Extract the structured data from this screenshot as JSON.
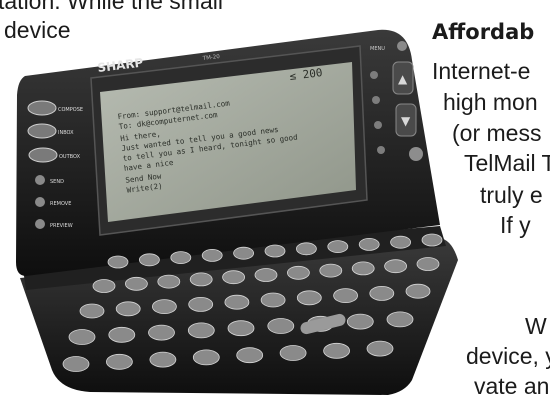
{
  "left_column": {
    "line1": "tation. While the small",
    "line2": "device"
  },
  "right_column": {
    "heading": "Affordab",
    "lines": [
      "Internet-e",
      "high mon",
      "(or mess",
      "TelMail T",
      "truly e",
      "If y",
      "W",
      "device, y",
      "vate an"
    ]
  },
  "device": {
    "brand": "SHARP",
    "model": "TM-20",
    "screen_text": "≤ 200",
    "screen_lines": [
      "From: support@telmail.com",
      "To: dk@computernet.com",
      "Hi there,",
      "Just wanted to tell you a good news",
      "to tell you as I heard, tonight so good",
      "have a nice",
      "Send Now",
      "Write(2)"
    ],
    "left_buttons": [
      "COMPOSE",
      "INBOX",
      "OUTBOX",
      "SEND",
      "REMOVE",
      "PREVIEW"
    ],
    "right_labels": [
      "MENU",
      "▲",
      "▼"
    ],
    "colors": {
      "body": "#1c1c1c",
      "screen": "#9ea49a",
      "keys": "#8a8a8a"
    }
  }
}
